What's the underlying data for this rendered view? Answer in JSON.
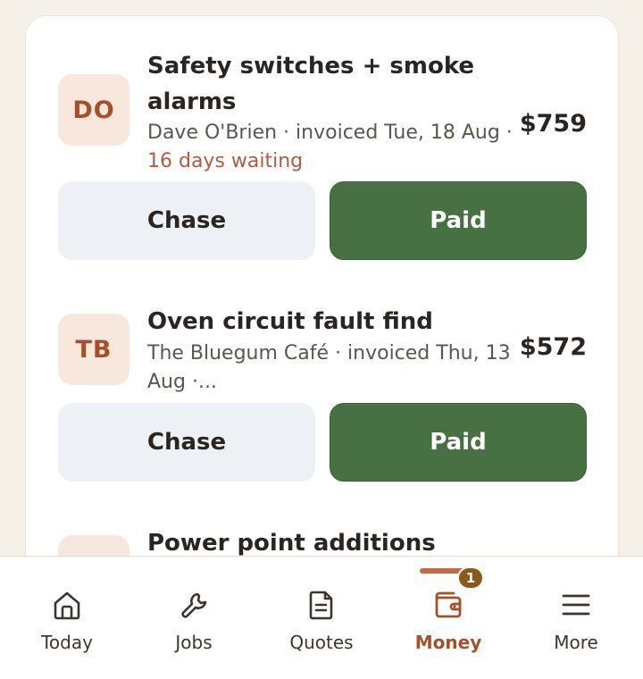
{
  "invoices": [
    {
      "initials": "DO",
      "title_line1": "Safety switches + smoke",
      "title_line2": "alarms",
      "meta_line1": "Dave O'Brien · invoiced Tue, 18 Aug ·",
      "meta_line2": "16 days waiting",
      "amount": "$759",
      "chase_label": "Chase",
      "paid_label": "Paid"
    },
    {
      "initials": "TB",
      "title_line1": "Oven circuit fault find",
      "meta_line1": "The Bluegum Café · invoiced Thu, 13",
      "meta_line2": "Aug ·...",
      "amount": "$572",
      "chase_label": "Chase",
      "paid_label": "Paid"
    },
    {
      "title_line1": "Power point additions"
    }
  ],
  "tabs": [
    {
      "label": "Today",
      "icon": "home-icon"
    },
    {
      "label": "Jobs",
      "icon": "wrench-icon"
    },
    {
      "label": "Quotes",
      "icon": "document-icon"
    },
    {
      "label": "Money",
      "icon": "wallet-icon",
      "active": true,
      "badge": "1"
    },
    {
      "label": "More",
      "icon": "menu-icon"
    }
  ],
  "colors": {
    "accent": "#a4502b",
    "paid_green": "#477142",
    "chase_bg": "#edf0f5",
    "waiting_red": "#b55a3e",
    "badge": "#8a5a1a"
  }
}
